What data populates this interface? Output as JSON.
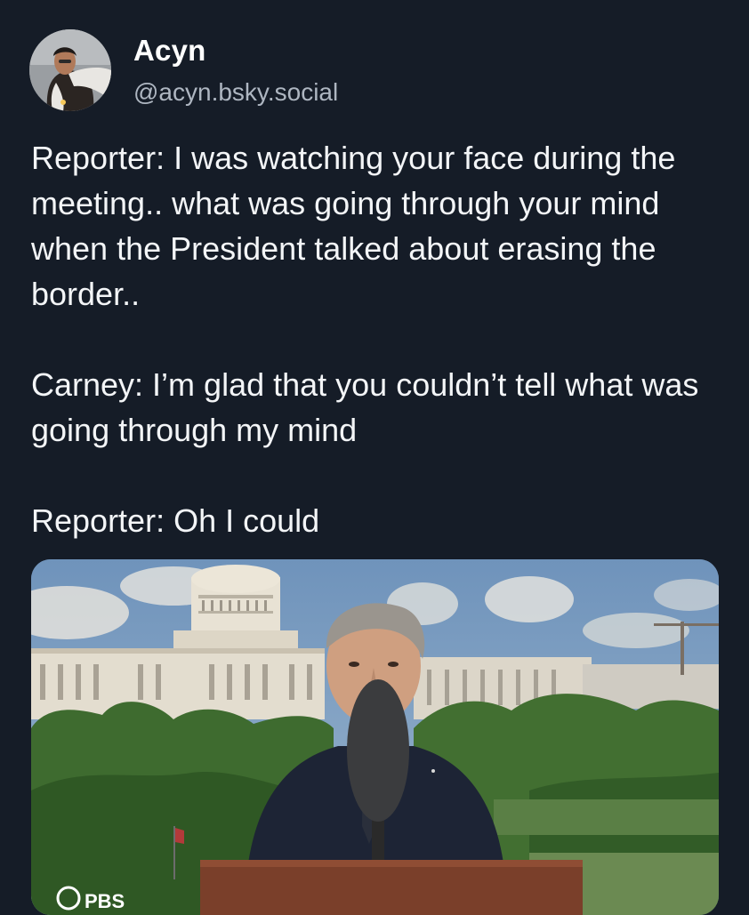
{
  "post": {
    "author": {
      "display_name": "Acyn",
      "handle": "@acyn.bsky.social"
    },
    "paragraphs": [
      "Reporter: I was watching your face during the meeting.. what was going through your mind when the President talked about erasing the border..",
      "Carney: I’m glad that you couldn’t tell what was going through my mind",
      "Reporter: Oh I could"
    ],
    "media": {
      "watermark_text": "PBS"
    }
  }
}
